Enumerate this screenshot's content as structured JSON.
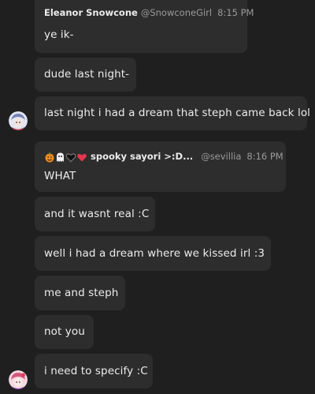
{
  "messages": [
    {
      "author": "Eleanor Snowcone",
      "handle": "@SnowconeGirl",
      "time": "8:15 PM",
      "text": "ye ik-"
    },
    {
      "text": "dude last night-"
    },
    {
      "text": "last night i had a dream that steph came back lol"
    },
    {
      "author": "spooky sayori >:D...",
      "author_icons": [
        "jack-o-lantern-icon",
        "ghost-icon",
        "black-heart-icon",
        "red-heart-icon"
      ],
      "handle": "@sevillia",
      "time": "8:16 PM",
      "text": "WHAT"
    },
    {
      "text": "and it wasnt real :C"
    },
    {
      "text": "well i had a dream where we kissed irl :3"
    },
    {
      "text": "me and steph"
    },
    {
      "text": "not you"
    },
    {
      "text": "i need to specify :C"
    }
  ],
  "colors": {
    "background": "#1f1f1f",
    "bubble": "#2d2d2d",
    "text": "#ececec",
    "muted": "#9a9a9a"
  }
}
